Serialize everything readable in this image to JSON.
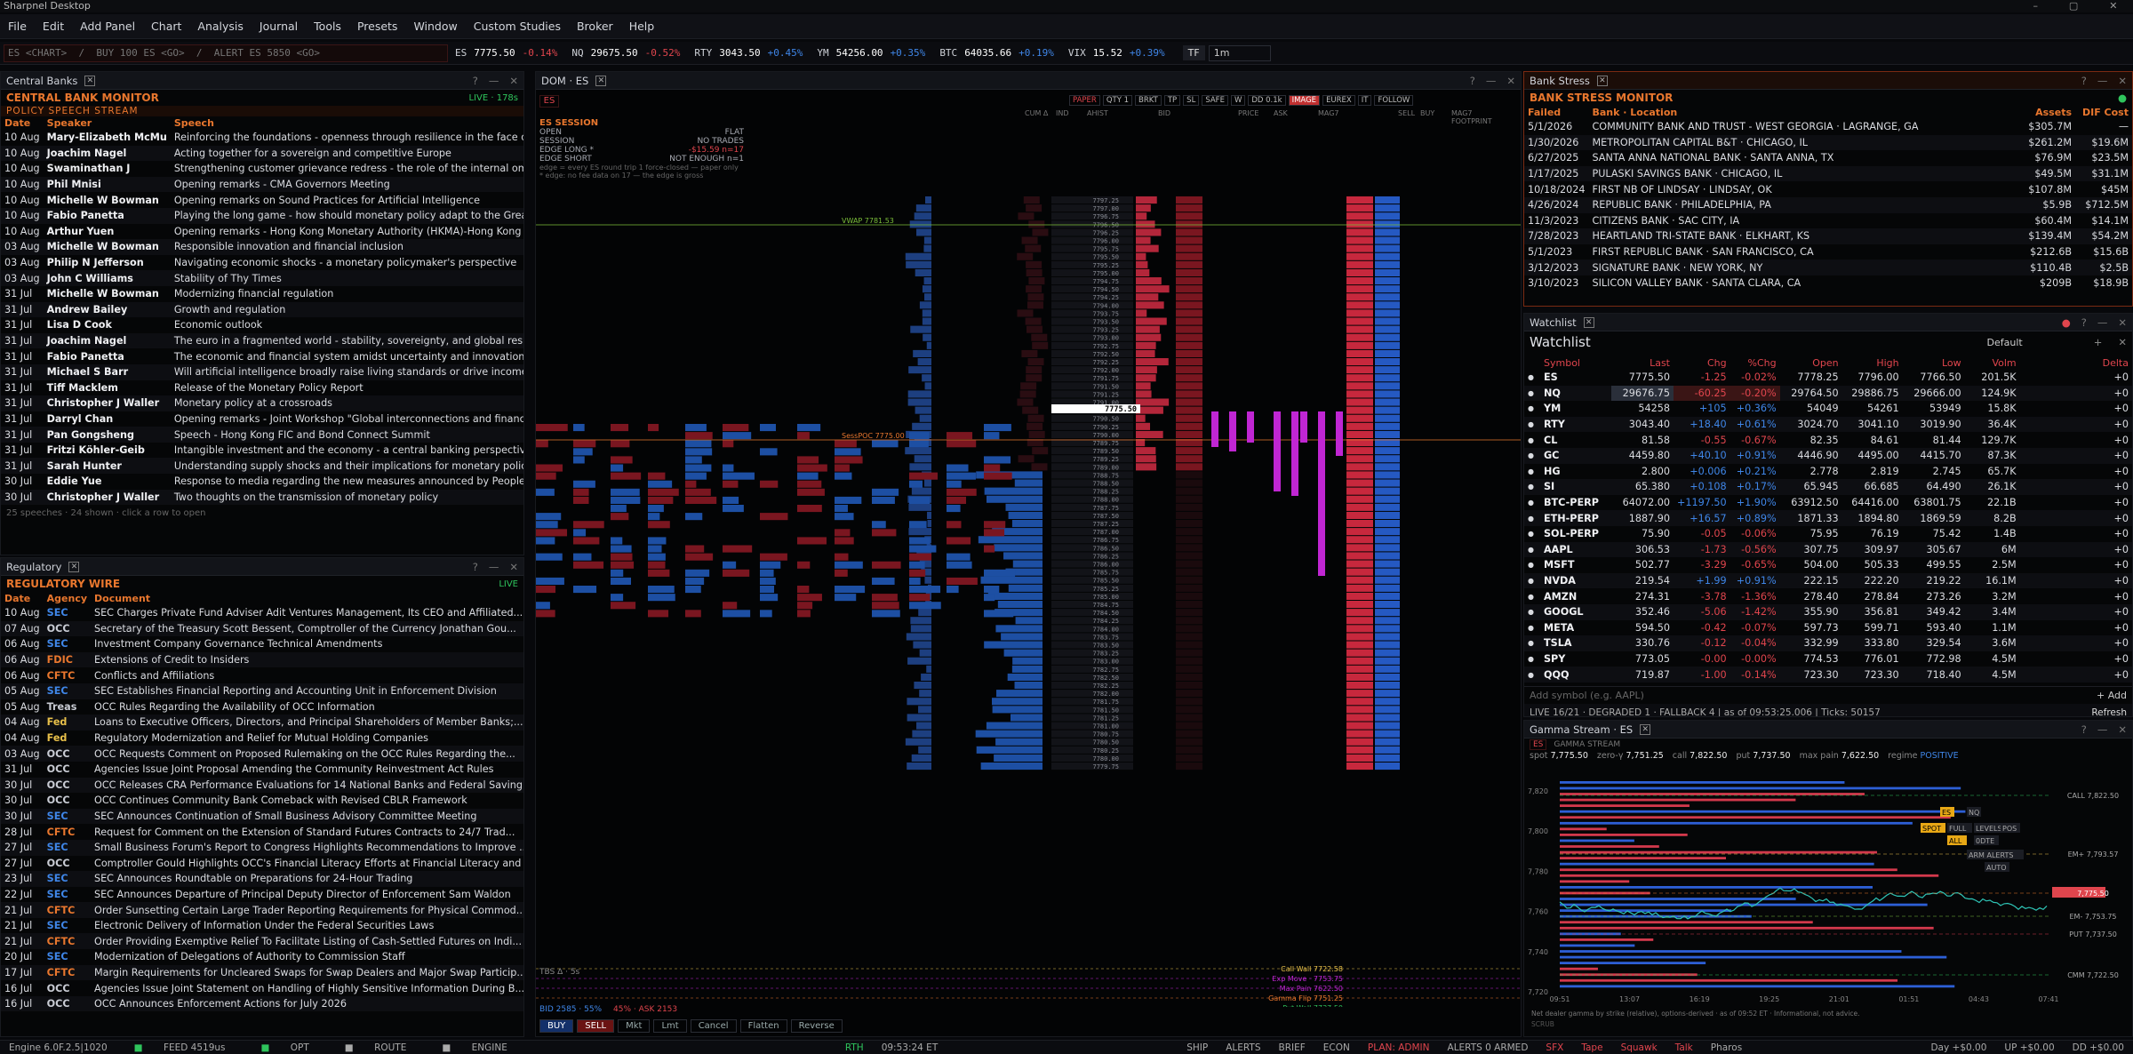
{
  "title": "Sharpnel Desktop",
  "menu": [
    "File",
    "Edit",
    "Add Panel",
    "Chart",
    "Analysis",
    "Journal",
    "Tools",
    "Presets",
    "Window",
    "Custom Studies",
    "Broker",
    "Help"
  ],
  "command_placeholder": "ES <CHART>  /  BUY 100 ES <GO>  /  ALERT ES 5850 <GO>",
  "tickers": [
    {
      "sym": "ES",
      "last": "7775.50",
      "chg": "-0.14%",
      "dir": "neg"
    },
    {
      "sym": "NQ",
      "last": "29675.50",
      "chg": "-0.52%",
      "dir": "neg"
    },
    {
      "sym": "RTY",
      "last": "3043.50",
      "chg": "+0.45%",
      "dir": "pos"
    },
    {
      "sym": "YM",
      "last": "54256.00",
      "chg": "+0.35%",
      "dir": "pos"
    },
    {
      "sym": "BTC",
      "last": "64035.66",
      "chg": "+0.19%",
      "dir": "pos"
    },
    {
      "sym": "VIX",
      "last": "15.52",
      "chg": "+0.39%",
      "dir": "pos"
    }
  ],
  "timeframe": {
    "label": "TF",
    "value": "1m"
  },
  "central_banks": {
    "tab": "Central Banks",
    "title": "CENTRAL BANK MONITOR",
    "live": "LIVE · 178s",
    "stream": "POLICY SPEECH STREAM",
    "columns": [
      "Date",
      "Speaker",
      "Speech"
    ],
    "rows": [
      [
        "10 Aug",
        "Mary-Elizabeth McMu",
        "Reinforcing the foundations - openness through resilience in the face of cha..."
      ],
      [
        "10 Aug",
        "Joachim Nagel",
        "Acting together for a sovereign and competitive Europe"
      ],
      [
        "10 Aug",
        "Swaminathan J",
        "Strengthening customer grievance redress - the role of the internal ombuds..."
      ],
      [
        "10 Aug",
        "Phil Mnisi",
        "Opening remarks - CMA Governors Meeting"
      ],
      [
        "10 Aug",
        "Michelle W Bowman",
        "Opening remarks on Sound Practices for Artificial Intelligence"
      ],
      [
        "10 Aug",
        "Fabio Panetta",
        "Playing the long game - how should monetary policy adapt to the Great Rec..."
      ],
      [
        "10 Aug",
        "Arthur Yuen",
        "Opening remarks - Hong Kong Monetary Authority (HKMA)-Hong Kong Asso..."
      ],
      [
        "03 Aug",
        "Michelle W Bowman",
        "Responsible innovation and financial inclusion"
      ],
      [
        "03 Aug",
        "Philip N Jefferson",
        "Navigating economic shocks - a monetary policymaker's perspective"
      ],
      [
        "03 Aug",
        "John C Williams",
        "Stability of Thy Times"
      ],
      [
        "31 Jul",
        "Michelle W Bowman",
        "Modernizing financial regulation"
      ],
      [
        "31 Jul",
        "Andrew Bailey",
        "Growth and regulation"
      ],
      [
        "31 Jul",
        "Lisa D Cook",
        "Economic outlook"
      ],
      [
        "31 Jul",
        "Joachim Nagel",
        "The euro in a fragmented world - stability, sovereignty, and global responsibi..."
      ],
      [
        "31 Jul",
        "Fabio Panetta",
        "The economic and financial system amidst uncertainty and innovation"
      ],
      [
        "31 Jul",
        "Michael S Barr",
        "Will artificial intelligence broadly raise living standards or drive income and we..."
      ],
      [
        "31 Jul",
        "Tiff Macklem",
        "Release of the Monetary Policy Report"
      ],
      [
        "31 Jul",
        "Christopher J Waller",
        "Monetary policy at a crossroads"
      ],
      [
        "31 Jul",
        "Darryl Chan",
        "Opening remarks - Joint Workshop \"Global interconnections and financial sta..."
      ],
      [
        "31 Jul",
        "Pan Gongsheng",
        "Speech - Hong Kong FIC and Bond Connect Summit"
      ],
      [
        "31 Jul",
        "Fritzi Köhler-Geib",
        "Intangible investment and the economy - a central banking perspective"
      ],
      [
        "31 Jul",
        "Sarah Hunter",
        "Understanding supply shocks and their implications for monetary policy"
      ],
      [
        "30 Jul",
        "Eddie Yue",
        "Response to media regarding the new measures announced by People Bank..."
      ],
      [
        "30 Jul",
        "Christopher J Waller",
        "Two thoughts on the transmission of monetary policy"
      ]
    ],
    "footer": "25 speeches · 24 shown · click a row to open"
  },
  "regulatory": {
    "tab": "Regulatory",
    "title": "REGULATORY WIRE",
    "live": "LIVE",
    "columns": [
      "Date",
      "Agency",
      "Document"
    ],
    "rows": [
      [
        "10 Aug",
        "SEC",
        "SEC Charges Private Fund Adviser Adit Ventures Management, Its CEO and Affiliated..."
      ],
      [
        "07 Aug",
        "OCC",
        "Secretary of the Treasury Scott Bessent, Comptroller of the Currency Jonathan Gou..."
      ],
      [
        "06 Aug",
        "SEC",
        "Investment Company Governance Technical Amendments"
      ],
      [
        "06 Aug",
        "FDIC",
        "Extensions of Credit to Insiders"
      ],
      [
        "06 Aug",
        "CFTC",
        "Conflicts and Affiliations"
      ],
      [
        "05 Aug",
        "SEC",
        "SEC Establishes Financial Reporting and Accounting Unit in Enforcement Division"
      ],
      [
        "05 Aug",
        "Treas",
        "OCC Rules Regarding the Availability of OCC Information"
      ],
      [
        "04 Aug",
        "Fed",
        "Loans to Executive Officers, Directors, and Principal Shareholders of Member Banks;..."
      ],
      [
        "04 Aug",
        "Fed",
        "Regulatory Modernization and Relief for Mutual Holding Companies"
      ],
      [
        "03 Aug",
        "OCC",
        "OCC Requests Comment on Proposed Rulemaking on the OCC Rules Regarding the..."
      ],
      [
        "31 Jul",
        "OCC",
        "Agencies Issue Joint Proposal Amending the Community Reinvestment Act Rules"
      ],
      [
        "30 Jul",
        "OCC",
        "OCC Releases CRA Performance Evaluations for 14 National Banks and Federal Saving..."
      ],
      [
        "30 Jul",
        "OCC",
        "OCC Continues Community Bank Comeback with Revised CBLR Framework"
      ],
      [
        "30 Jul",
        "SEC",
        "SEC Announces Continuation of Small Business Advisory Committee Meeting"
      ],
      [
        "28 Jul",
        "CFTC",
        "Request for Comment on the Extension of Standard Futures Contracts to 24/7 Trad..."
      ],
      [
        "27 Jul",
        "SEC",
        "Small Business Forum's Report to Congress Highlights Recommendations to Improve ..."
      ],
      [
        "27 Jul",
        "OCC",
        "Comptroller Gould Highlights OCC's Financial Literacy Efforts at Financial Literacy and ..."
      ],
      [
        "23 Jul",
        "SEC",
        "SEC Announces Roundtable on Preparations for 24-Hour Trading"
      ],
      [
        "22 Jul",
        "SEC",
        "SEC Announces Departure of Principal Deputy Director of Enforcement Sam Waldon"
      ],
      [
        "21 Jul",
        "CFTC",
        "Order Sunsetting Certain Large Trader Reporting Requirements for Physical Commod..."
      ],
      [
        "21 Jul",
        "SEC",
        "Electronic Delivery of Information Under the Federal Securities Laws"
      ],
      [
        "21 Jul",
        "CFTC",
        "Order Providing Exemptive Relief To Facilitate Listing of Cash-Settled Futures on Indi..."
      ],
      [
        "20 Jul",
        "SEC",
        "Modernization of Delegations of Authority to Commission Staff"
      ],
      [
        "17 Jul",
        "CFTC",
        "Margin Requirements for Uncleared Swaps for Swap Dealers and Major Swap Particip..."
      ],
      [
        "16 Jul",
        "OCC",
        "Agencies Issue Joint Statement on Handling of Highly Sensitive Information During B..."
      ],
      [
        "16 Jul",
        "OCC",
        "OCC Announces Enforcement Actions for July 2026"
      ]
    ]
  },
  "dom": {
    "tab": "DOM · ES",
    "symbol": "ES",
    "top_buttons": [
      "PAPER",
      "QTY 1",
      "BRKT",
      "TP",
      "SL",
      "SAFE",
      "W",
      "DD 0.1k",
      "IMAGE",
      "EUREX",
      "IT",
      "FOLLOW"
    ],
    "session": {
      "title": "ES SESSION",
      "rows": [
        [
          "OPEN",
          "FLAT"
        ],
        [
          "SESSION",
          "NO TRADES"
        ],
        [
          "EDGE LONG *",
          "-$15.59 n=17"
        ],
        [
          "EDGE SHORT",
          "NOT ENOUGH n=1"
        ]
      ],
      "note1": "edge = every ES round trip 1 force-closed — paper only",
      "note2": "* edge: no fee data on 17 — the edge is gross"
    },
    "col_heads": [
      "CUM Δ",
      "IND",
      "AHIST",
      "BID",
      "PRICE",
      "ASK",
      "MAG7",
      "SELL",
      "BUY",
      "MAG7 FOOTPRINT"
    ],
    "vwap": "VWAP  7781.53",
    "sesspoc": "SessPOC  7775.00",
    "last_price": "7775.50",
    "levels": [
      "Call Wall 7722.58",
      "Exp Move · 7753.75",
      "Max Pain 7622.50",
      "Gamma Flip 7751.25",
      "Put Wall 7737.50"
    ],
    "tbs": "TBS Δ · 5s",
    "bidask": {
      "bid": "BID 2585 · 55%",
      "ask": "45% · ASK 2153"
    },
    "order_buttons": [
      "BUY",
      "SELL",
      "Mkt",
      "Lmt",
      "Cancel",
      "Flatten",
      "Reverse"
    ]
  },
  "bank_stress": {
    "tab": "Bank Stress",
    "title": "BANK STRESS MONITOR",
    "columns": [
      "Failed",
      "Bank · Location",
      "Assets",
      "DIF Cost"
    ],
    "rows": [
      [
        "5/1/2026",
        "COMMUNITY BANK AND TRUST - WEST GEORGIA · LAGRANGE, GA",
        "$305.7M",
        "—"
      ],
      [
        "1/30/2026",
        "METROPOLITAN CAPITAL B&T · CHICAGO, IL",
        "$261.2M",
        "$19.6M"
      ],
      [
        "6/27/2025",
        "SANTA ANNA NATIONAL BANK · SANTA ANNA, TX",
        "$76.9M",
        "$23.5M"
      ],
      [
        "1/17/2025",
        "PULASKI SAVINGS BANK · CHICAGO, IL",
        "$49.5M",
        "$31.1M"
      ],
      [
        "10/18/2024",
        "FIRST NB OF LINDSAY · LINDSAY, OK",
        "$107.8M",
        "$45M"
      ],
      [
        "4/26/2024",
        "REPUBLIC BANK · PHILADELPHIA, PA",
        "$5.9B",
        "$712.5M"
      ],
      [
        "11/3/2023",
        "CITIZENS BANK · SAC CITY, IA",
        "$60.4M",
        "$14.1M"
      ],
      [
        "7/28/2023",
        "HEARTLAND TRI-STATE BANK · ELKHART, KS",
        "$139.4M",
        "$54.2M"
      ],
      [
        "5/1/2023",
        "FIRST REPUBLIC BANK · SAN FRANCISCO, CA",
        "$212.6B",
        "$15.6B"
      ],
      [
        "3/12/2023",
        "SIGNATURE BANK · NEW YORK, NY",
        "$110.4B",
        "$2.5B"
      ],
      [
        "3/10/2023",
        "SILICON VALLEY BANK · SANTA CLARA, CA",
        "$209B",
        "$18.9B"
      ]
    ]
  },
  "watchlist": {
    "tab": "Watchlist",
    "title": "Watchlist",
    "preset": "Default",
    "columns": [
      "Symbol",
      "Last",
      "Chg",
      "%Chg",
      "Open",
      "High",
      "Low",
      "Volm",
      "Delta"
    ],
    "rows": [
      [
        "ES",
        "7775.50",
        "-1.25",
        "-0.02%",
        "7778.25",
        "7796.00",
        "7766.50",
        "201.5K",
        "+0",
        "neg"
      ],
      [
        "NQ",
        "29676.75",
        "-60.25",
        "-0.20%",
        "29764.50",
        "29886.75",
        "29666.00",
        "124.9K",
        "+0",
        "neg"
      ],
      [
        "YM",
        "54258",
        "+105",
        "+0.36%",
        "54049",
        "54261",
        "53949",
        "15.8K",
        "+0",
        "pos"
      ],
      [
        "RTY",
        "3043.40",
        "+18.40",
        "+0.61%",
        "3024.70",
        "3041.10",
        "3019.90",
        "36.4K",
        "+0",
        "pos"
      ],
      [
        "CL",
        "81.58",
        "-0.55",
        "-0.67%",
        "82.35",
        "84.61",
        "81.44",
        "129.7K",
        "+0",
        "neg"
      ],
      [
        "GC",
        "4459.80",
        "+40.10",
        "+0.91%",
        "4446.90",
        "4495.00",
        "4415.70",
        "87.3K",
        "+0",
        "pos"
      ],
      [
        "HG",
        "2.800",
        "+0.006",
        "+0.21%",
        "2.778",
        "2.819",
        "2.745",
        "65.7K",
        "+0",
        "pos"
      ],
      [
        "SI",
        "65.380",
        "+0.108",
        "+0.17%",
        "65.945",
        "66.685",
        "64.490",
        "26.1K",
        "+0",
        "pos"
      ],
      [
        "BTC-PERP",
        "64072.00",
        "+1197.50",
        "+1.90%",
        "63912.50",
        "64416.00",
        "63801.75",
        "22.1B",
        "+0",
        "pos"
      ],
      [
        "ETH-PERP",
        "1887.90",
        "+16.57",
        "+0.89%",
        "1871.33",
        "1894.80",
        "1869.59",
        "8.2B",
        "+0",
        "pos"
      ],
      [
        "SOL-PERP",
        "75.90",
        "-0.05",
        "-0.06%",
        "75.95",
        "76.19",
        "75.42",
        "1.4B",
        "+0",
        "neg"
      ],
      [
        "AAPL",
        "306.53",
        "-1.73",
        "-0.56%",
        "307.75",
        "309.97",
        "305.67",
        "6M",
        "+0",
        "neg"
      ],
      [
        "MSFT",
        "502.77",
        "-3.29",
        "-0.65%",
        "504.00",
        "505.33",
        "499.55",
        "2.5M",
        "+0",
        "neg"
      ],
      [
        "NVDA",
        "219.54",
        "+1.99",
        "+0.91%",
        "222.15",
        "222.20",
        "219.22",
        "16.1M",
        "+0",
        "pos"
      ],
      [
        "AMZN",
        "274.31",
        "-3.78",
        "-1.36%",
        "278.40",
        "278.84",
        "273.26",
        "3.2M",
        "+0",
        "neg"
      ],
      [
        "GOOGL",
        "352.46",
        "-5.06",
        "-1.42%",
        "355.90",
        "356.81",
        "349.42",
        "3.4M",
        "+0",
        "neg"
      ],
      [
        "META",
        "594.50",
        "-0.42",
        "-0.07%",
        "597.73",
        "599.71",
        "593.40",
        "1.1M",
        "+0",
        "neg"
      ],
      [
        "TSLA",
        "330.76",
        "-0.12",
        "-0.04%",
        "332.99",
        "333.80",
        "329.54",
        "3.6M",
        "+0",
        "neg"
      ],
      [
        "SPY",
        "773.05",
        "-0.00",
        "-0.00%",
        "774.53",
        "776.01",
        "772.98",
        "4.5M",
        "+0",
        "neg"
      ],
      [
        "QQQ",
        "719.87",
        "-1.00",
        "-0.14%",
        "723.30",
        "723.30",
        "718.40",
        "4.5M",
        "+0",
        "neg"
      ]
    ],
    "add_placeholder": "Add symbol  (e.g. AAPL)",
    "add_button": "+ Add",
    "status": "LIVE 16/21 · DEGRADED 1 · FALLBACK 4   |  as of 09:53:25.006  |  Ticks: 50157",
    "refresh": "Refresh"
  },
  "gamma": {
    "tab": "Gamma Stream · ES",
    "symbol": "ES",
    "subtitle": "GAMMA STREAM",
    "stats": [
      [
        "spot",
        "7,775.50"
      ],
      [
        "zero-γ",
        "7,751.25"
      ],
      [
        "call",
        "7,822.50"
      ],
      [
        "put",
        "7,737.50"
      ],
      [
        "max pain",
        "7,622.50"
      ],
      [
        "regime",
        "POSITIVE"
      ]
    ],
    "y_ticks": [
      "7,820",
      "7,800",
      "7,780",
      "7,760",
      "7,740",
      "7,720"
    ],
    "x_ticks": [
      "09:51",
      "13:07",
      "16:19",
      "19:25",
      "21:01",
      "01:51",
      "04:43",
      "07:41"
    ],
    "right_labels": [
      "CALL 7,822.50",
      "EM+ 7,793.57",
      "7,775.50",
      "EM- 7,753.75",
      "PUT 7,737.50",
      "CMM 7,722.50"
    ],
    "tags": [
      "ES",
      "NQ",
      "SPOT",
      "FULL",
      "LEVELS",
      "POS",
      "ALL",
      "0DTE",
      "ARM ALERTS",
      "AUTO"
    ],
    "note": "Net dealer gamma by strike (relative), options-derived · as of 09:52 ET · Informational, not advice.",
    "scrub": "SCRUB"
  },
  "statusbar": {
    "engine": "Engine 6.0F.2.5|1020",
    "feed": "FEED 4519us",
    "opt": "OPT",
    "route": "ROUTE",
    "eng": "ENGINE",
    "rth": "RTH",
    "clock": "09:53:24 ET",
    "ship": "SHIP",
    "alerts": "ALERTS",
    "brief": "BRIEF",
    "econ": "ECON",
    "plan": "PLAN: ADMIN",
    "alerts2": "ALERTS 0 ARMED",
    "sfx": "SFX",
    "tape": "Tape",
    "squawk": "Squawk",
    "talk": "Talk",
    "pharos": "Pharos",
    "pnl": "Day +$0.00",
    "up": "UP +$0.00",
    "dd": "DD +$0.00"
  },
  "colors": {
    "accent": "#e9772e",
    "neg": "#e0454d",
    "pos": "#3f86e8",
    "live": "#2fc45c",
    "magenta": "#c026d3"
  }
}
